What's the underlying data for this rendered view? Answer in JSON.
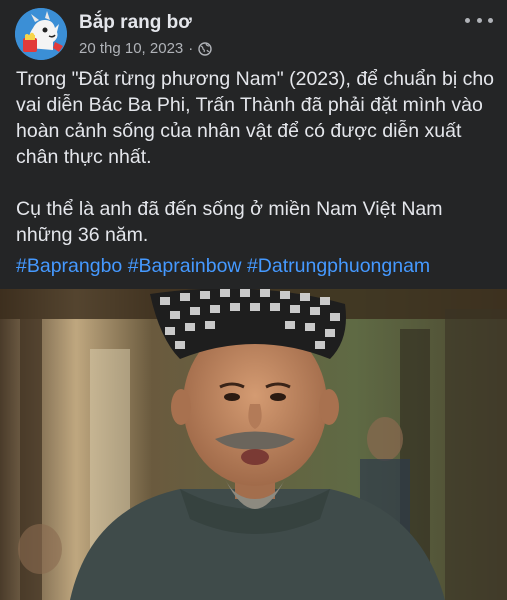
{
  "post": {
    "page_name": "Bắp rang bơ",
    "date": "20 thg 10, 2023",
    "separator": "·",
    "audience_icon": "globe-icon",
    "more_icon": "more-horizontal-icon",
    "caption_line_1": "Trong \"Đất rừng phương Nam\" (2023), để chuẩn bị cho vai diễn Bác Ba Phi, Trấn Thành đã phải đặt mình vào hoàn cảnh sống của nhân vật để có được diễn xuất chân thực nhất.",
    "caption_line_2": "Cụ thể là anh đã đến sống ở miền Nam Việt Nam những 36 năm.",
    "hashtags": [
      "#Baprangbo",
      "#Baprainbow",
      "#Datrungphuongnam"
    ]
  },
  "colors": {
    "background": "#242526",
    "text": "#e4e6eb",
    "secondary_text": "#b0b3b8",
    "link": "#4599ff"
  }
}
